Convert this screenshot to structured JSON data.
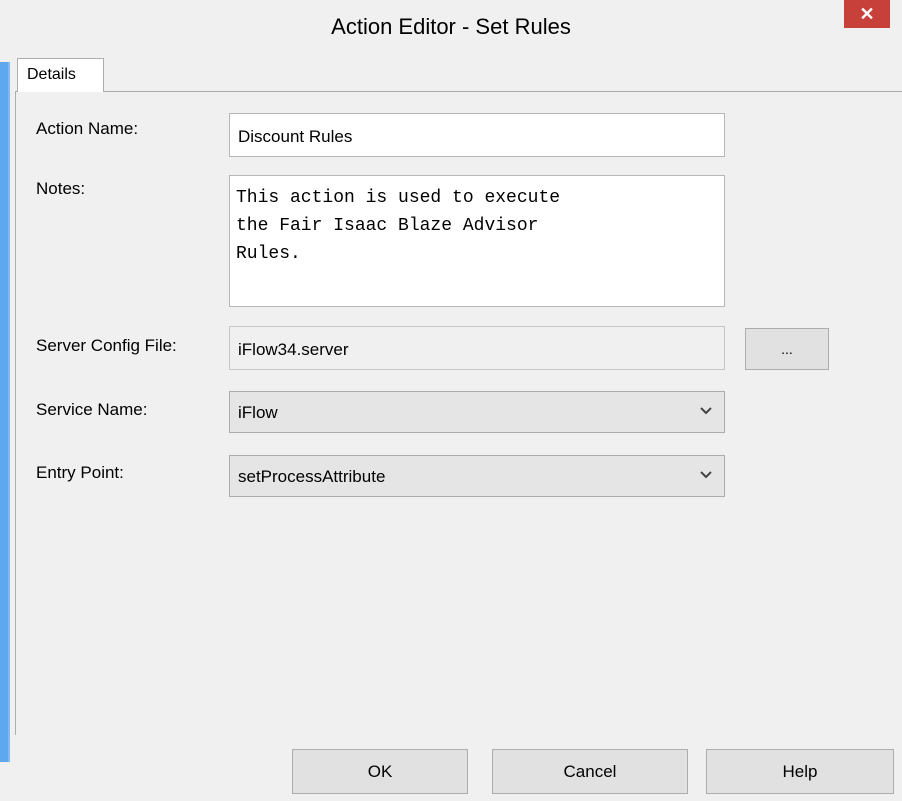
{
  "window": {
    "title": "Action Editor - Set Rules",
    "close_glyph": "✕"
  },
  "tabs": [
    {
      "label": "Details"
    }
  ],
  "form": {
    "action_name": {
      "label": "Action Name:",
      "value": "Discount Rules"
    },
    "notes": {
      "label": "Notes:",
      "value": "This action is used to execute\nthe Fair Isaac Blaze Advisor\nRules."
    },
    "server_config_file": {
      "label": "Server Config File:",
      "value": "iFlow34.server",
      "browse_label": "..."
    },
    "service_name": {
      "label": "Service Name:",
      "value": "iFlow"
    },
    "entry_point": {
      "label": "Entry Point:",
      "value": "setProcessAttribute"
    }
  },
  "buttons": {
    "ok": "OK",
    "cancel": "Cancel",
    "help": "Help"
  },
  "colors": {
    "close_button": "#c7413a",
    "window_border": "#5fa8ef"
  }
}
